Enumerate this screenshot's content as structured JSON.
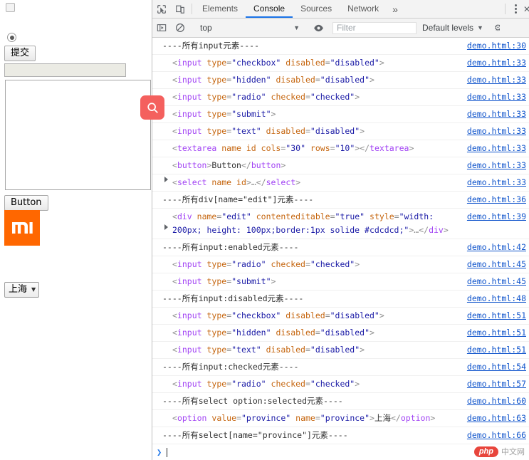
{
  "page": {
    "checkbox_state": "unchecked-disabled",
    "radio_state": "checked",
    "submit_label": "提交",
    "text_input_value": "",
    "textarea_value": "",
    "button_label": "Button",
    "logo_text": "mi",
    "logo_color": "#ff6700",
    "select_value": "上海",
    "select_caret": "▼"
  },
  "search_badge": {
    "icon": "search-icon",
    "color": "#f4605e"
  },
  "devtools": {
    "icons": {
      "inspect": "inspect-element-icon",
      "device": "device-toolbar-icon",
      "sidebar": "console-sidebar-icon",
      "clear": "clear-console-icon",
      "eye": "eye-icon",
      "kebab": "more-options-icon"
    },
    "tabs": [
      {
        "label": "Elements",
        "active": false
      },
      {
        "label": "Console",
        "active": true
      },
      {
        "label": "Sources",
        "active": false
      },
      {
        "label": "Network",
        "active": false
      }
    ],
    "more_tabs": "»",
    "filterbar": {
      "context": "top",
      "context_caret": "▼",
      "filter_placeholder": "Filter",
      "filter_value": "",
      "levels_label": "Default levels",
      "levels_caret": "▼"
    },
    "prompt": {
      "chevron": "❯"
    }
  },
  "console_messages": [
    {
      "kind": "plain",
      "indent": 0,
      "triangle": false,
      "source": "demo.html:30",
      "parts": [
        {
          "c": "plain",
          "t": "----所有input元素----"
        }
      ]
    },
    {
      "kind": "node",
      "indent": 1,
      "triangle": false,
      "source": "demo.html:33",
      "parts": [
        {
          "c": "pn",
          "t": "<"
        },
        {
          "c": "tg",
          "t": "input"
        },
        {
          "c": "an",
          "t": " type"
        },
        {
          "c": "pn",
          "t": "="
        },
        {
          "c": "av",
          "t": "\"checkbox\""
        },
        {
          "c": "an",
          "t": " disabled"
        },
        {
          "c": "pn",
          "t": "="
        },
        {
          "c": "av",
          "t": "\"disabled\""
        },
        {
          "c": "pn",
          "t": ">"
        }
      ]
    },
    {
      "kind": "node",
      "indent": 1,
      "triangle": false,
      "source": "demo.html:33",
      "parts": [
        {
          "c": "pn",
          "t": "<"
        },
        {
          "c": "tg",
          "t": "input"
        },
        {
          "c": "an",
          "t": " type"
        },
        {
          "c": "pn",
          "t": "="
        },
        {
          "c": "av",
          "t": "\"hidden\""
        },
        {
          "c": "an",
          "t": " disabled"
        },
        {
          "c": "pn",
          "t": "="
        },
        {
          "c": "av",
          "t": "\"disabled\""
        },
        {
          "c": "pn",
          "t": ">"
        }
      ]
    },
    {
      "kind": "node",
      "indent": 1,
      "triangle": false,
      "source": "demo.html:33",
      "parts": [
        {
          "c": "pn",
          "t": "<"
        },
        {
          "c": "tg",
          "t": "input"
        },
        {
          "c": "an",
          "t": " type"
        },
        {
          "c": "pn",
          "t": "="
        },
        {
          "c": "av",
          "t": "\"radio\""
        },
        {
          "c": "an",
          "t": " checked"
        },
        {
          "c": "pn",
          "t": "="
        },
        {
          "c": "av",
          "t": "\"checked\""
        },
        {
          "c": "pn",
          "t": ">"
        }
      ]
    },
    {
      "kind": "node",
      "indent": 1,
      "triangle": false,
      "source": "demo.html:33",
      "parts": [
        {
          "c": "pn",
          "t": "<"
        },
        {
          "c": "tg",
          "t": "input"
        },
        {
          "c": "an",
          "t": " type"
        },
        {
          "c": "pn",
          "t": "="
        },
        {
          "c": "av",
          "t": "\"submit\""
        },
        {
          "c": "pn",
          "t": ">"
        }
      ]
    },
    {
      "kind": "node",
      "indent": 1,
      "triangle": false,
      "source": "demo.html:33",
      "parts": [
        {
          "c": "pn",
          "t": "<"
        },
        {
          "c": "tg",
          "t": "input"
        },
        {
          "c": "an",
          "t": " type"
        },
        {
          "c": "pn",
          "t": "="
        },
        {
          "c": "av",
          "t": "\"text\""
        },
        {
          "c": "an",
          "t": " disabled"
        },
        {
          "c": "pn",
          "t": "="
        },
        {
          "c": "av",
          "t": "\"disabled\""
        },
        {
          "c": "pn",
          "t": ">"
        }
      ]
    },
    {
      "kind": "node",
      "indent": 1,
      "triangle": false,
      "source": "demo.html:33",
      "parts": [
        {
          "c": "pn",
          "t": "<"
        },
        {
          "c": "tg",
          "t": "textarea"
        },
        {
          "c": "an",
          "t": " name"
        },
        {
          "c": "an",
          "t": " id"
        },
        {
          "c": "an",
          "t": " cols"
        },
        {
          "c": "pn",
          "t": "="
        },
        {
          "c": "av",
          "t": "\"30\""
        },
        {
          "c": "an",
          "t": " rows"
        },
        {
          "c": "pn",
          "t": "="
        },
        {
          "c": "av",
          "t": "\"10\""
        },
        {
          "c": "pn",
          "t": "></"
        },
        {
          "c": "tg",
          "t": "textarea"
        },
        {
          "c": "pn",
          "t": ">"
        }
      ]
    },
    {
      "kind": "node",
      "indent": 1,
      "triangle": false,
      "source": "demo.html:33",
      "parts": [
        {
          "c": "pn",
          "t": "<"
        },
        {
          "c": "tg",
          "t": "button"
        },
        {
          "c": "pn",
          "t": ">"
        },
        {
          "c": "tx",
          "t": "Button"
        },
        {
          "c": "pn",
          "t": "</"
        },
        {
          "c": "tg",
          "t": "button"
        },
        {
          "c": "pn",
          "t": ">"
        }
      ]
    },
    {
      "kind": "node",
      "indent": 1,
      "triangle": true,
      "source": "demo.html:33",
      "parts": [
        {
          "c": "pn",
          "t": "<"
        },
        {
          "c": "tg",
          "t": "select"
        },
        {
          "c": "an",
          "t": " name"
        },
        {
          "c": "an",
          "t": " id"
        },
        {
          "c": "pn",
          "t": ">"
        },
        {
          "c": "pn",
          "t": "…"
        },
        {
          "c": "pn",
          "t": "</"
        },
        {
          "c": "tg",
          "t": "select"
        },
        {
          "c": "pn",
          "t": ">"
        }
      ]
    },
    {
      "kind": "plain",
      "indent": 0,
      "triangle": false,
      "source": "demo.html:36",
      "parts": [
        {
          "c": "plain",
          "t": "----所有div[name=\"edit\"]元素----"
        }
      ]
    },
    {
      "kind": "node",
      "indent": 1,
      "triangle": true,
      "multiline": true,
      "source": "demo.html:39",
      "parts": [
        {
          "c": "pn",
          "t": "<"
        },
        {
          "c": "tg",
          "t": "div"
        },
        {
          "c": "an",
          "t": " name"
        },
        {
          "c": "pn",
          "t": "="
        },
        {
          "c": "av",
          "t": "\"edit\""
        },
        {
          "c": "an",
          "t": " contenteditable"
        },
        {
          "c": "pn",
          "t": "="
        },
        {
          "c": "av",
          "t": "\"true\""
        },
        {
          "c": "an",
          "t": " style"
        },
        {
          "c": "pn",
          "t": "="
        },
        {
          "c": "av",
          "t": "\"width: 200px; height: 100px;border:1px solide #cdcdcd;\""
        },
        {
          "c": "pn",
          "t": ">"
        },
        {
          "c": "pn",
          "t": "…"
        },
        {
          "c": "pn",
          "t": "</"
        },
        {
          "c": "tg",
          "t": "div"
        },
        {
          "c": "pn",
          "t": ">"
        }
      ]
    },
    {
      "kind": "plain",
      "indent": 0,
      "triangle": false,
      "source": "demo.html:42",
      "parts": [
        {
          "c": "plain",
          "t": "----所有input:enabled元素----"
        }
      ]
    },
    {
      "kind": "node",
      "indent": 1,
      "triangle": false,
      "source": "demo.html:45",
      "parts": [
        {
          "c": "pn",
          "t": "<"
        },
        {
          "c": "tg",
          "t": "input"
        },
        {
          "c": "an",
          "t": " type"
        },
        {
          "c": "pn",
          "t": "="
        },
        {
          "c": "av",
          "t": "\"radio\""
        },
        {
          "c": "an",
          "t": " checked"
        },
        {
          "c": "pn",
          "t": "="
        },
        {
          "c": "av",
          "t": "\"checked\""
        },
        {
          "c": "pn",
          "t": ">"
        }
      ]
    },
    {
      "kind": "node",
      "indent": 1,
      "triangle": false,
      "source": "demo.html:45",
      "parts": [
        {
          "c": "pn",
          "t": "<"
        },
        {
          "c": "tg",
          "t": "input"
        },
        {
          "c": "an",
          "t": " type"
        },
        {
          "c": "pn",
          "t": "="
        },
        {
          "c": "av",
          "t": "\"submit\""
        },
        {
          "c": "pn",
          "t": ">"
        }
      ]
    },
    {
      "kind": "plain",
      "indent": 0,
      "triangle": false,
      "source": "demo.html:48",
      "parts": [
        {
          "c": "plain",
          "t": "----所有input:disabled元素----"
        }
      ]
    },
    {
      "kind": "node",
      "indent": 1,
      "triangle": false,
      "source": "demo.html:51",
      "parts": [
        {
          "c": "pn",
          "t": "<"
        },
        {
          "c": "tg",
          "t": "input"
        },
        {
          "c": "an",
          "t": " type"
        },
        {
          "c": "pn",
          "t": "="
        },
        {
          "c": "av",
          "t": "\"checkbox\""
        },
        {
          "c": "an",
          "t": " disabled"
        },
        {
          "c": "pn",
          "t": "="
        },
        {
          "c": "av",
          "t": "\"disabled\""
        },
        {
          "c": "pn",
          "t": ">"
        }
      ]
    },
    {
      "kind": "node",
      "indent": 1,
      "triangle": false,
      "source": "demo.html:51",
      "parts": [
        {
          "c": "pn",
          "t": "<"
        },
        {
          "c": "tg",
          "t": "input"
        },
        {
          "c": "an",
          "t": " type"
        },
        {
          "c": "pn",
          "t": "="
        },
        {
          "c": "av",
          "t": "\"hidden\""
        },
        {
          "c": "an",
          "t": " disabled"
        },
        {
          "c": "pn",
          "t": "="
        },
        {
          "c": "av",
          "t": "\"disabled\""
        },
        {
          "c": "pn",
          "t": ">"
        }
      ]
    },
    {
      "kind": "node",
      "indent": 1,
      "triangle": false,
      "source": "demo.html:51",
      "parts": [
        {
          "c": "pn",
          "t": "<"
        },
        {
          "c": "tg",
          "t": "input"
        },
        {
          "c": "an",
          "t": " type"
        },
        {
          "c": "pn",
          "t": "="
        },
        {
          "c": "av",
          "t": "\"text\""
        },
        {
          "c": "an",
          "t": " disabled"
        },
        {
          "c": "pn",
          "t": "="
        },
        {
          "c": "av",
          "t": "\"disabled\""
        },
        {
          "c": "pn",
          "t": ">"
        }
      ]
    },
    {
      "kind": "plain",
      "indent": 0,
      "triangle": false,
      "source": "demo.html:54",
      "parts": [
        {
          "c": "plain",
          "t": "----所有input:checked元素----"
        }
      ]
    },
    {
      "kind": "node",
      "indent": 1,
      "triangle": false,
      "source": "demo.html:57",
      "parts": [
        {
          "c": "pn",
          "t": "<"
        },
        {
          "c": "tg",
          "t": "input"
        },
        {
          "c": "an",
          "t": " type"
        },
        {
          "c": "pn",
          "t": "="
        },
        {
          "c": "av",
          "t": "\"radio\""
        },
        {
          "c": "an",
          "t": " checked"
        },
        {
          "c": "pn",
          "t": "="
        },
        {
          "c": "av",
          "t": "\"checked\""
        },
        {
          "c": "pn",
          "t": ">"
        }
      ]
    },
    {
      "kind": "plain",
      "indent": 0,
      "triangle": false,
      "source": "demo.html:60",
      "parts": [
        {
          "c": "plain",
          "t": "----所有select option:selected元素----"
        }
      ]
    },
    {
      "kind": "node",
      "indent": 1,
      "triangle": false,
      "multiline": true,
      "source": "demo.html:63",
      "parts": [
        {
          "c": "pn",
          "t": "<"
        },
        {
          "c": "tg",
          "t": "option"
        },
        {
          "c": "an",
          "t": " value"
        },
        {
          "c": "pn",
          "t": "="
        },
        {
          "c": "av",
          "t": "\"province\""
        },
        {
          "c": "an",
          "t": " name"
        },
        {
          "c": "pn",
          "t": "="
        },
        {
          "c": "av",
          "t": "\"province\""
        },
        {
          "c": "pn",
          "t": ">"
        },
        {
          "c": "tx",
          "t": "上海"
        },
        {
          "c": "pn",
          "t": "</"
        },
        {
          "c": "tg",
          "t": "option"
        },
        {
          "c": "pn",
          "t": ">"
        }
      ]
    },
    {
      "kind": "plain",
      "indent": 0,
      "triangle": false,
      "source": "demo.html:66",
      "parts": [
        {
          "c": "plain",
          "t": "----所有select[name=\"province\"]元素----"
        }
      ]
    }
  ],
  "watermark": {
    "php": "php",
    "cn": "中文网"
  }
}
